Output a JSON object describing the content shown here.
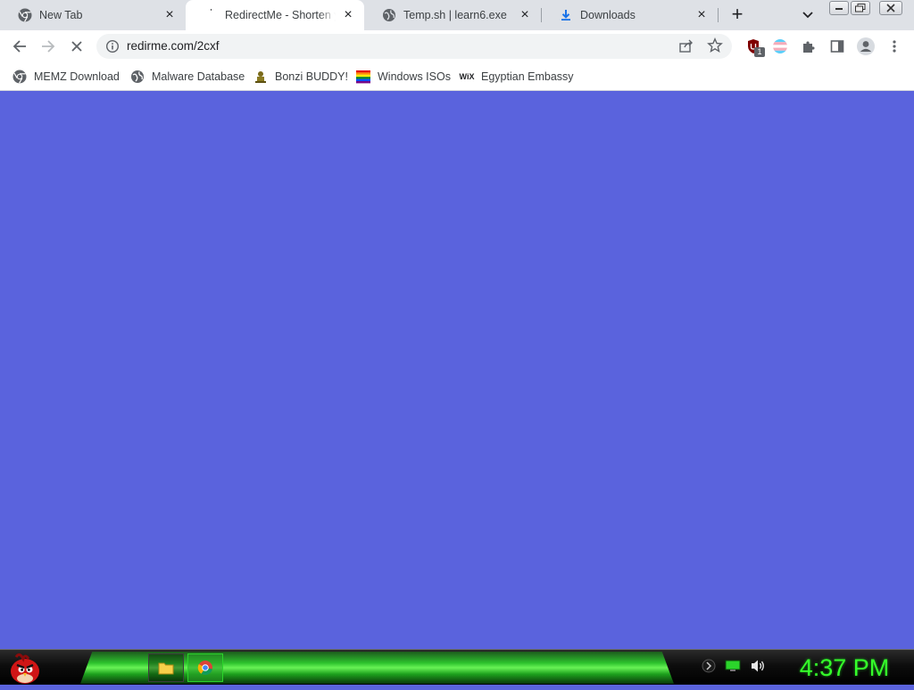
{
  "browser": {
    "tabs": [
      {
        "title": "New Tab",
        "icon": "chrome-icon",
        "active": false
      },
      {
        "title": "RedirectMe - Shorten your",
        "icon": "loading-icon",
        "active": true
      },
      {
        "title": "Temp.sh | learn6.exe",
        "icon": "globe-icon",
        "active": false
      },
      {
        "title": "Downloads",
        "icon": "download-icon",
        "active": false
      }
    ],
    "new_tab_label": "+",
    "address_bar": {
      "url": "redirme.com/2cxf"
    },
    "extension_badge": "1",
    "bookmarks": [
      {
        "label": "MEMZ Download",
        "icon": "chrome-icon"
      },
      {
        "label": "Malware Database",
        "icon": "globe-icon"
      },
      {
        "label": "Bonzi BUDDY!",
        "icon": "bonzi-icon"
      },
      {
        "label": "Windows ISOs",
        "icon": "rainbow-flag-icon"
      },
      {
        "label": "Egyptian Embassy",
        "icon": "wix-icon"
      }
    ],
    "bookmark_wix_text": "WiX"
  },
  "page": {
    "background": "#5a63dd"
  },
  "taskbar": {
    "clock": "4:37 PM",
    "apps": [
      "file-explorer-icon",
      "chrome-icon"
    ]
  },
  "colors": {
    "clock_green": "#35ff2a",
    "accent_green": "#2ecb2e",
    "page_blue": "#5a63dd"
  }
}
